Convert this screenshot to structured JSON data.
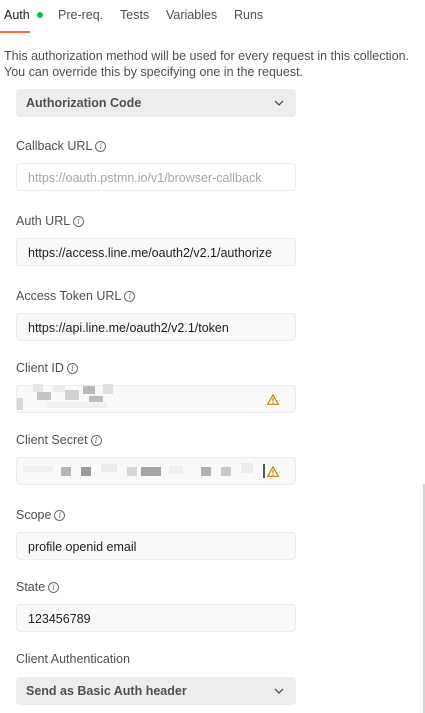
{
  "tabs": [
    {
      "label": "Auth",
      "active": true,
      "has_indicator": true
    },
    {
      "label": "Pre-req.",
      "active": false
    },
    {
      "label": "Tests",
      "active": false
    },
    {
      "label": "Variables",
      "active": false
    },
    {
      "label": "Runs",
      "active": false
    }
  ],
  "colors": {
    "accent": "#ff6c37",
    "indicator": "#0cbb52",
    "warning": "#b88600"
  },
  "description": "This authorization method will be used for every request in this collection. You can override this by specifying one in the request.",
  "grant_type": {
    "value": "Authorization Code",
    "icon": "chevron-down-icon"
  },
  "fields": {
    "callback_url": {
      "label": "Callback URL",
      "value": "https://oauth.pstmn.io/v1/browser-callback",
      "readonly": true,
      "info_icon": "info-icon"
    },
    "auth_url": {
      "label": "Auth URL",
      "value": "https://access.line.me/oauth2/v2.1/authorize",
      "info_icon": "info-icon"
    },
    "access_token_url": {
      "label": "Access Token URL",
      "value": "https://api.line.me/oauth2/v2.1/token",
      "info_icon": "info-icon"
    },
    "client_id": {
      "label": "Client ID",
      "value": "",
      "masked": true,
      "warning_icon": "warning-icon",
      "info_icon": "info-icon"
    },
    "client_secret": {
      "label": "Client Secret",
      "value": "",
      "masked": true,
      "warning_icon": "warning-icon",
      "info_icon": "info-icon"
    },
    "scope": {
      "label": "Scope",
      "value": "profile openid email",
      "info_icon": "info-icon"
    },
    "state": {
      "label": "State",
      "value": "123456789",
      "info_icon": "info-icon"
    }
  },
  "client_authentication": {
    "label": "Client Authentication",
    "value": "Send as Basic Auth header",
    "icon": "chevron-down-icon"
  }
}
